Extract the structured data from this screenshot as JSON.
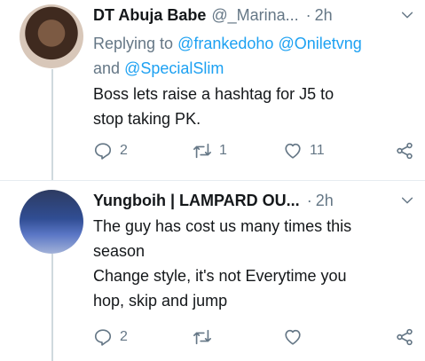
{
  "tweets": [
    {
      "author_name": "DT Abuja Babe",
      "author_handle": "@_Marina...",
      "separator": "·",
      "time": "2h",
      "reply_prefix": "Replying to",
      "reply_mentions": [
        "@frankedoho",
        "@Oniletvng"
      ],
      "reply_and": "and",
      "reply_last": "@SpecialSlim",
      "text": "Boss lets raise a hashtag for J5 to\nstop taking PK.",
      "replies": "2",
      "retweets": "1",
      "likes": "11"
    },
    {
      "author_name": "Yungboih | LAMPARD OU...",
      "separator": "·",
      "time": "2h",
      "text": "The guy has cost us many times this\nseason\nChange style, it's not Everytime you\nhop, skip and jump",
      "replies": "2"
    }
  ],
  "icons": {
    "reply": "reply-icon",
    "retweet": "retweet-icon",
    "like": "heart-icon",
    "share": "share-icon",
    "more": "chevron-down-icon"
  },
  "colors": {
    "text": "#14171a",
    "muted": "#657786",
    "accent": "#1da1f2",
    "divider": "#e6ecf0"
  }
}
